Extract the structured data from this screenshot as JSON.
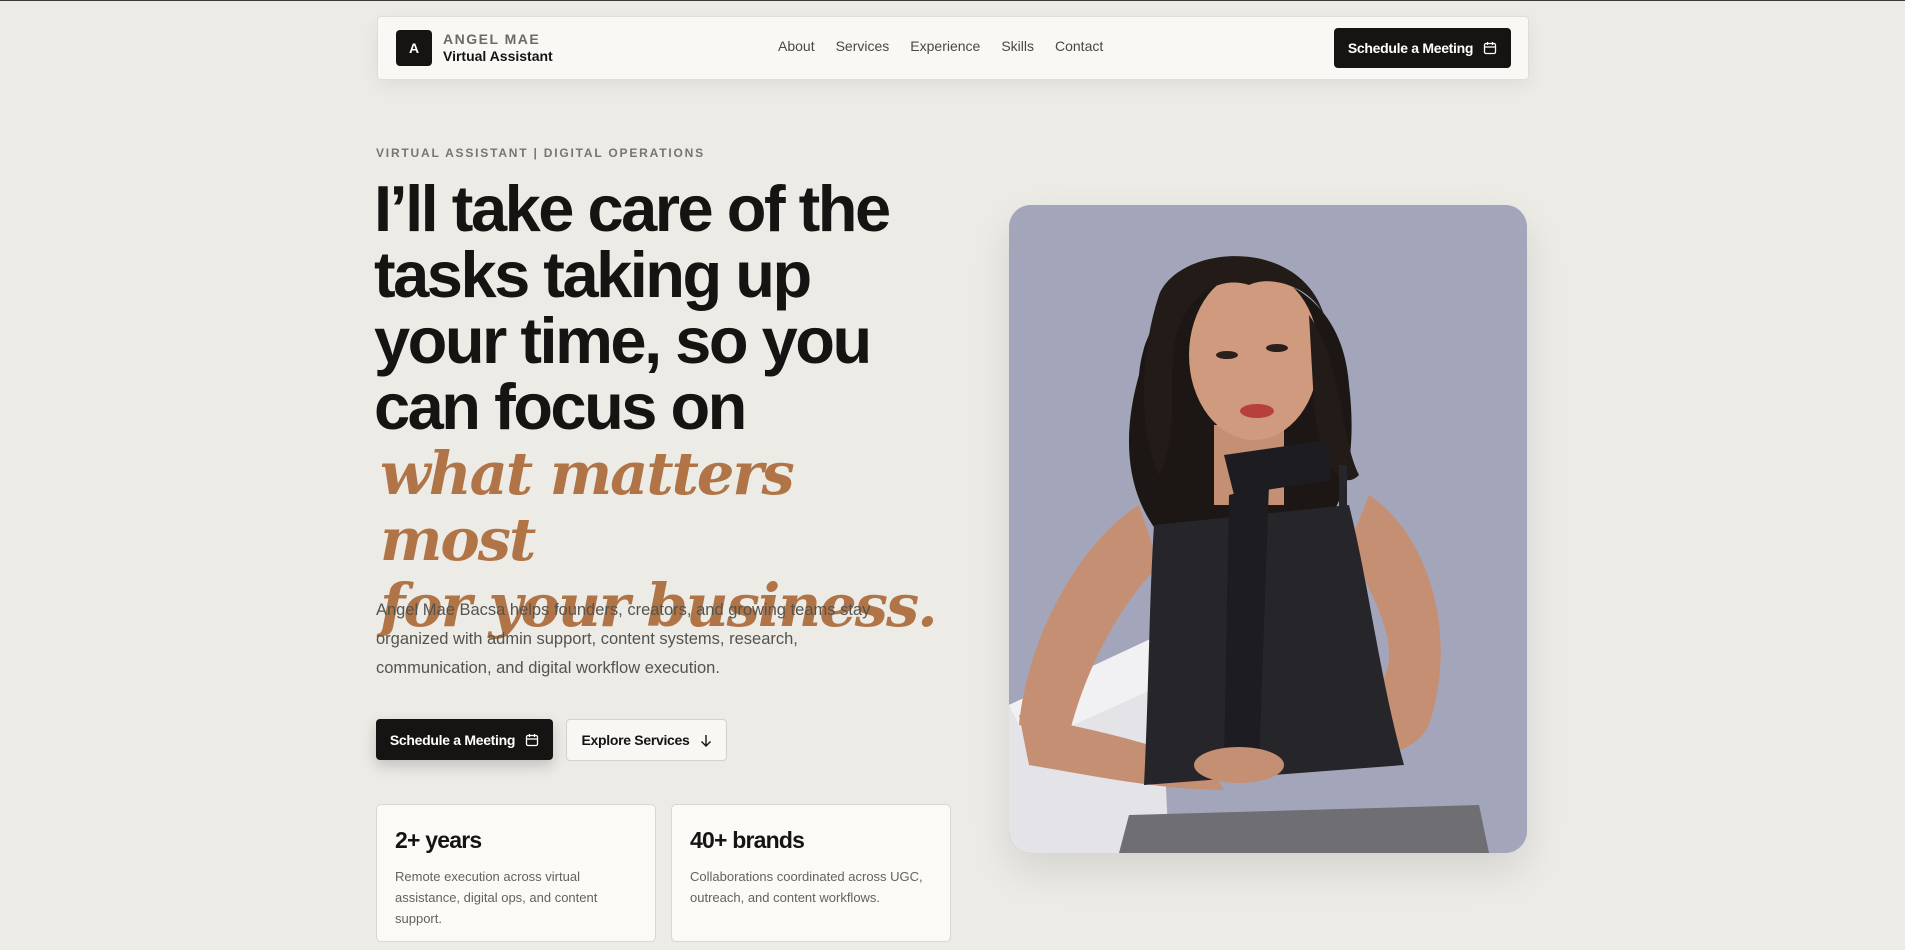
{
  "nav": {
    "brand_initial": "A",
    "brand_name": "ANGEL MAE",
    "brand_role": "Virtual Assistant",
    "links": [
      "About",
      "Services",
      "Experience",
      "Skills",
      "Contact"
    ],
    "cta_label": "Schedule a Meeting"
  },
  "hero": {
    "eyebrow": "VIRTUAL ASSISTANT | DIGITAL OPERATIONS",
    "headline_lines": [
      "I’ll take care of the",
      "tasks taking up",
      "your time, so you",
      "can focus on"
    ],
    "accent_lines": [
      "what matters most",
      "for your business."
    ],
    "lede": "Angel Mae Bacsa helps founders, creators, and growing teams stay organized with admin support, content systems, research, communication, and digital workflow execution.",
    "primary_cta": "Schedule a Meeting",
    "secondary_cta": "Explore Services"
  },
  "stats": [
    {
      "value": "2+ years",
      "desc": "Remote execution across virtual assistance, digital ops, and content support."
    },
    {
      "value": "40+ brands",
      "desc": "Collaborations coordinated across UGC, outreach, and content workflows."
    }
  ],
  "icons": {
    "calendar": "calendar-icon",
    "arrow": "arrow-down-icon"
  },
  "colors": {
    "background": "#ecebe6",
    "ink": "#151412",
    "accent": "#b07446",
    "card": "#fbfaf7"
  }
}
